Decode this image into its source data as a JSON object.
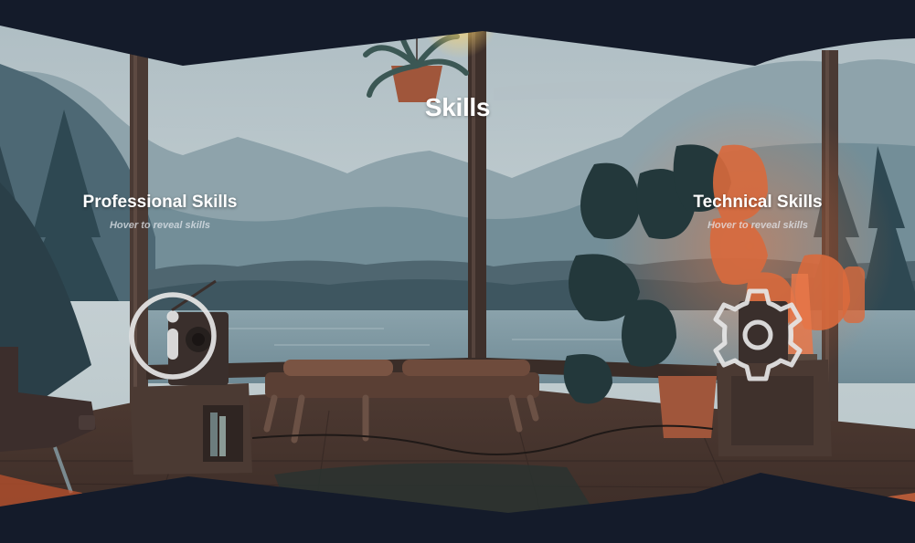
{
  "page": {
    "heading": "Skills"
  },
  "sections": {
    "professional": {
      "title": "Professional Skills",
      "hint": "Hover to reveal skills",
      "icon": "info-circle-icon"
    },
    "technical": {
      "title": "Technical Skills",
      "hint": "Hover to reveal skills",
      "icon": "gear-icon"
    }
  },
  "colors": {
    "frame": "#141b2a",
    "text": "#ffffff",
    "icon_stroke": "#e6e6e6",
    "accent_orange": "#e2673c"
  }
}
